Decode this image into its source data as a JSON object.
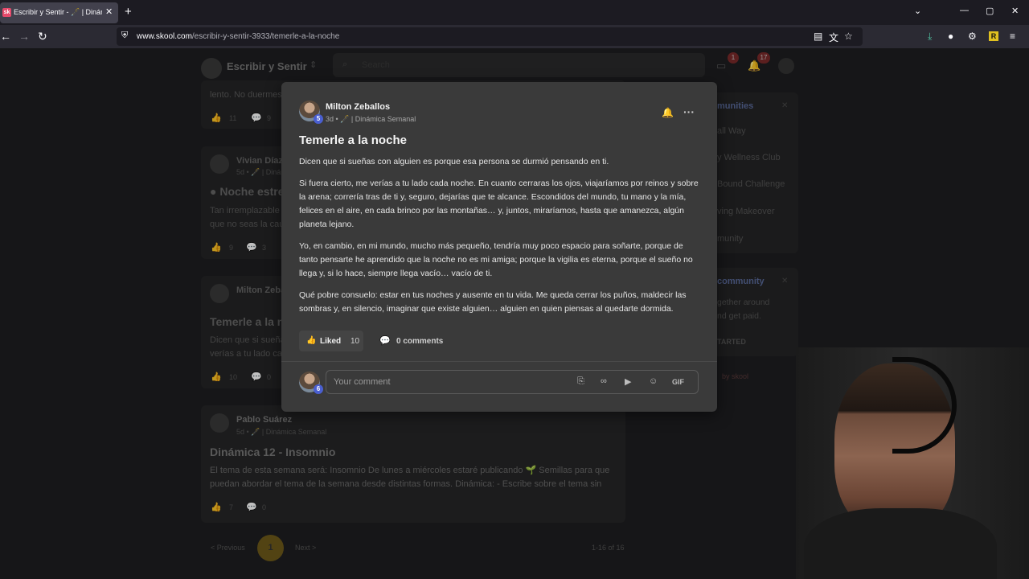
{
  "browser": {
    "tab_title": "Escribir y Sentir - 🖋️ | Dinámica",
    "tab_favicon": "sk",
    "url_domain": "www.skool.com",
    "url_path": "/escribir-y-sentir-3933/temerle-a-la-noche"
  },
  "app": {
    "group_name": "Escribir y Sentir",
    "search_placeholder": "Search",
    "chat_badge": "1",
    "notif_badge": "17"
  },
  "background_feed": {
    "snippet_top": "lento. No duermes",
    "snippet_top_likes": "11",
    "snippet_top_comments": "9",
    "post2_author": "Vivian Díaz",
    "post2_meta": "5d • 🖋️ | Dinámica",
    "post2_title": "● Noche estre",
    "post2_excerpt_1": "Tan irremplazable",
    "post2_excerpt_2": "que no seas la cau",
    "post2_likes": "9",
    "post2_comments": "3",
    "post3_author": "Milton Zeba",
    "post3_title": "Temerle a la no",
    "post3_excerpt_1": "Dicen que si sueña",
    "post3_excerpt_2": "verías a tu lado ca",
    "post3_likes": "10",
    "post3_comments": "0",
    "post4_author": "Pablo Suárez",
    "post4_meta": "5d • 🖋️ | Dinámica Semanal",
    "post4_title": "Dinámica 12 - Insomnio",
    "post4_excerpt_1": "El tema de esta semana será: Insomnio De lunes a miércoles estaré publicando 🌱 Semillas para que",
    "post4_excerpt_2": "puedan abordar el tema de la semana desde distintas formas. Dinámica: - Escribe sobre el tema sin",
    "post4_likes": "7",
    "post4_comments": "0",
    "pager_prev": "< Previous",
    "pager_page": "1",
    "pager_next": "Next >",
    "pager_range": "1-16 of 16",
    "side1_title": "munities",
    "side1_items": [
      "all Way",
      "y Wellness Club",
      "Bound Challenge",
      "ving Makeover",
      "munity"
    ],
    "side2_title": "community",
    "side2_text_1": "gether around",
    "side2_text_2": "nd get paid.",
    "side2_cta": "TARTED",
    "side2_powered": "by skool"
  },
  "post": {
    "author": "Milton Zeballos",
    "author_level": "5",
    "time": "3d",
    "category": "🖋️ | Dinámica Semanal",
    "title": "Temerle a la noche",
    "paragraphs": [
      "Dicen que si sueñas con alguien es porque esa persona se durmió pensando en ti.",
      "Si fuera cierto, me verías a tu lado cada noche. En cuanto cerraras los ojos, viajaríamos por reinos y sobre la arena; correría tras de ti y, seguro, dejarías que te alcance. Escondidos del mundo, tu mano y la mía, felices en el aire, en cada brinco por las montañas… y, juntos, miraríamos, hasta que amanezca, algún planeta lejano.",
      "Yo, en cambio, en mi mundo, mucho más pequeño, tendría muy poco espacio para soñarte, porque de tanto pensarte he aprendido que la noche no es mi amiga; porque la vigilia es eterna, porque el sueño no llega y, si lo hace, siempre llega vacío… vacío de ti.",
      "Qué pobre consuelo: estar en tus noches y ausente en tu vida. Me queda cerrar los puños, maldecir las sombras y, en silencio, imaginar que existe alguien… alguien en quien piensas al quedarte dormida."
    ],
    "liked_label": "Liked",
    "likes": "10",
    "comments_label": "0 comments",
    "comment_placeholder": "Your comment",
    "commenter_level": "6",
    "gif_label": "GIF"
  },
  "colors": {
    "accent_level": "#4a5fd0",
    "like_thumb": "#f0c050",
    "pager_active": "#c9a227"
  }
}
